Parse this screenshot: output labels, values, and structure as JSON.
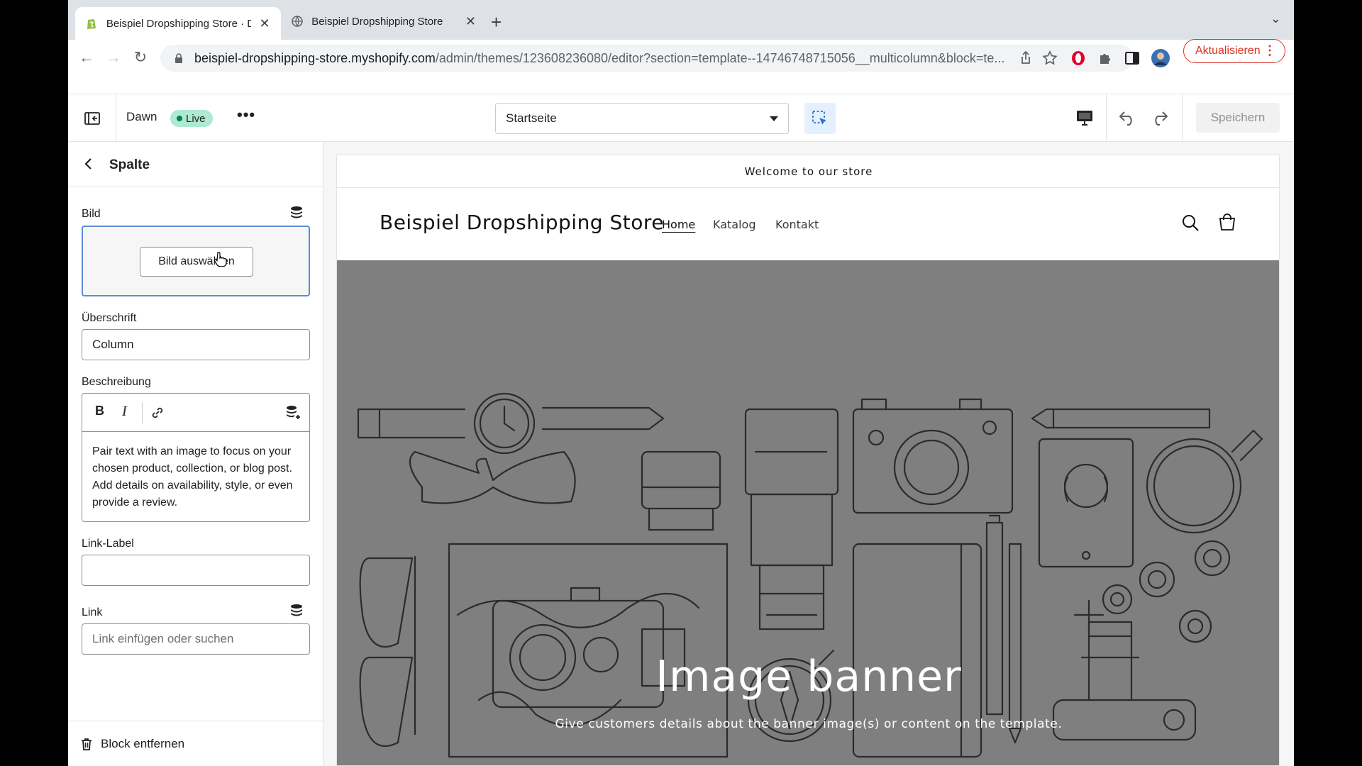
{
  "browser": {
    "tabs": [
      {
        "title": "Beispiel Dropshipping Store · D",
        "active": true,
        "favicon": "shopify-icon"
      },
      {
        "title": "Beispiel Dropshipping Store",
        "active": false,
        "favicon": "globe-icon"
      }
    ],
    "url_host": "beispiel-dropshipping-store.myshopify.com",
    "url_rest": "/admin/themes/123608236080/editor?section=template--14746748715056__multicolumn&block=te...",
    "update_label": "Aktualisieren"
  },
  "editor": {
    "theme_name": "Dawn",
    "live_label": "Live",
    "page_select": "Startseite",
    "save_label": "Speichern"
  },
  "sidebar": {
    "title": "Spalte",
    "image_label": "Bild",
    "image_button": "Bild auswählen",
    "heading_label": "Überschrift",
    "heading_value": "Column",
    "description_label": "Beschreibung",
    "description_text": "Pair text with an image to focus on your chosen product, collection, or blog post. Add details on availability, style, or even provide a review.",
    "link_label_label": "Link-Label",
    "link_label_value": "",
    "link_label": "Link",
    "link_placeholder": "Link einfügen oder suchen",
    "remove_block": "Block entfernen"
  },
  "preview": {
    "announcement": "Welcome to our store",
    "store_name": "Beispiel Dropshipping Store",
    "nav": [
      "Home",
      "Katalog",
      "Kontakt"
    ],
    "banner_heading": "Image banner",
    "banner_sub": "Give customers details about the banner image(s) or content on the template."
  },
  "colors": {
    "accent_blue": "#5c8bd6",
    "live_green": "#aee9d1",
    "banner_gray": "#7f7f7f",
    "update_red": "#d93025"
  }
}
